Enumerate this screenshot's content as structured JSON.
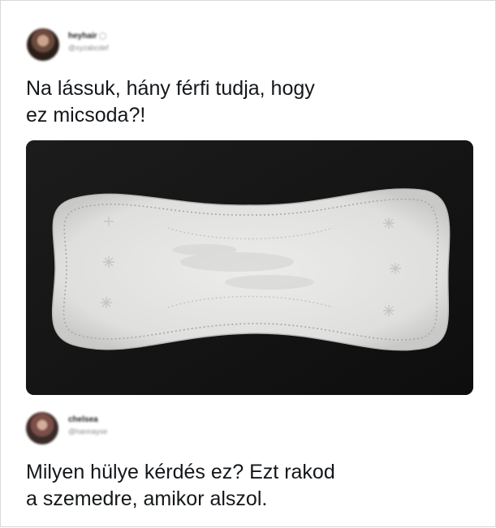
{
  "tweets": [
    {
      "display_name": "heyhair",
      "username": "@xyzabcdef",
      "text_lines": [
        "Na lássuk, hány férfi tudja, hogy",
        "ez micsoda?!"
      ],
      "image": "panty-liner-photo"
    },
    {
      "display_name": "chelsea",
      "username": "@hannayxe",
      "text_lines": [
        "Milyen hülye kérdés ez? Ezt rakod",
        "a szemedre, amikor alszol."
      ]
    }
  ],
  "colors": {
    "text": "#14171a",
    "photo_background": "#151515",
    "liner": "#e6e7e5"
  }
}
